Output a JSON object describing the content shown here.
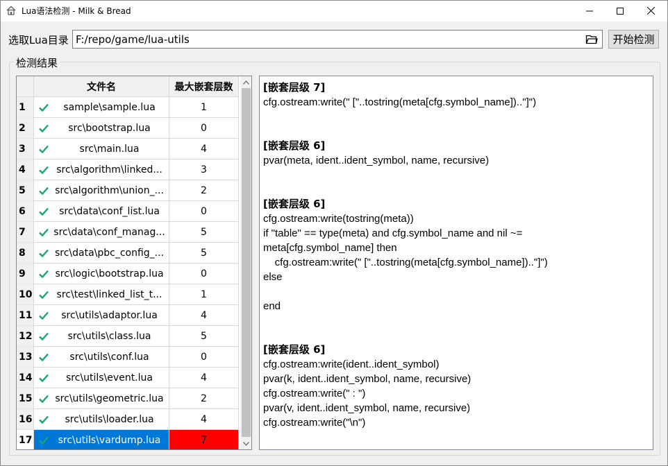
{
  "window": {
    "title": "Lua语法检测 - Milk & Bread",
    "icon": "home-icon",
    "controls": [
      "minimize-icon",
      "maximize-icon",
      "close-icon"
    ]
  },
  "toolbar": {
    "dir_label": "选取Lua目录",
    "path_value": "F:/repo/game/lua-utils",
    "browse_icon": "folder-icon",
    "start_label": "开始检测"
  },
  "results": {
    "group_title": "检测结果",
    "columns": {
      "filename": "文件名",
      "max_depth": "最大嵌套层数"
    },
    "rows": [
      {
        "num": "1",
        "name": "sample\\sample.lua",
        "depth": "1"
      },
      {
        "num": "2",
        "name": "src\\bootstrap.lua",
        "depth": "0"
      },
      {
        "num": "3",
        "name": "src\\main.lua",
        "depth": "4"
      },
      {
        "num": "4",
        "name": "src\\algorithm\\linked...",
        "depth": "3"
      },
      {
        "num": "5",
        "name": "src\\algorithm\\union_...",
        "depth": "2"
      },
      {
        "num": "6",
        "name": "src\\data\\conf_list.lua",
        "depth": "0"
      },
      {
        "num": "7",
        "name": "src\\data\\conf_manag...",
        "depth": "5"
      },
      {
        "num": "8",
        "name": "src\\data\\pbc_config_...",
        "depth": "5"
      },
      {
        "num": "9",
        "name": "src\\logic\\bootstrap.lua",
        "depth": "0"
      },
      {
        "num": "10",
        "name": "src\\test\\linked_list_t...",
        "depth": "1"
      },
      {
        "num": "11",
        "name": "src\\utils\\adaptor.lua",
        "depth": "4"
      },
      {
        "num": "12",
        "name": "src\\utils\\class.lua",
        "depth": "5"
      },
      {
        "num": "13",
        "name": "src\\utils\\conf.lua",
        "depth": "0"
      },
      {
        "num": "14",
        "name": "src\\utils\\event.lua",
        "depth": "4"
      },
      {
        "num": "15",
        "name": "src\\utils\\geometric.lua",
        "depth": "2"
      },
      {
        "num": "16",
        "name": "src\\utils\\loader.lua",
        "depth": "4"
      },
      {
        "num": "17",
        "name": "src\\utils\\vardump.lua",
        "depth": "7"
      }
    ],
    "selected_row": "17",
    "status_icon": "checkmark-icon",
    "status_color": "#1aa37a",
    "selected_bg": "#0078d7",
    "warning_bg": "#ff0000"
  },
  "detail": {
    "blocks": [
      {
        "title": "[嵌套层级 7]",
        "lines": [
          "cfg.ostream:write(\" [\"..tostring(meta[cfg.symbol_name])..\"]\")"
        ]
      },
      {
        "title": "[嵌套层级 6]",
        "lines": [
          "pvar(meta, ident..ident_symbol, name, recursive)"
        ]
      },
      {
        "title": "[嵌套层级 6]",
        "lines": [
          "cfg.ostream:write(tostring(meta))",
          "if \"table\" == type(meta) and cfg.symbol_name and nil ~=",
          "meta[cfg.symbol_name] then",
          "    cfg.ostream:write(\" [\"..tostring(meta[cfg.symbol_name])..\"]\")",
          "else",
          "",
          "end"
        ]
      },
      {
        "title": "[嵌套层级 6]",
        "lines": [
          "cfg.ostream:write(ident..ident_symbol)",
          "pvar(k, ident..ident_symbol, name, recursive)",
          "cfg.ostream:write(\" : \")",
          "pvar(v, ident..ident_symbol, name, recursive)",
          "cfg.ostream:write(\"\\n\")"
        ]
      }
    ]
  }
}
